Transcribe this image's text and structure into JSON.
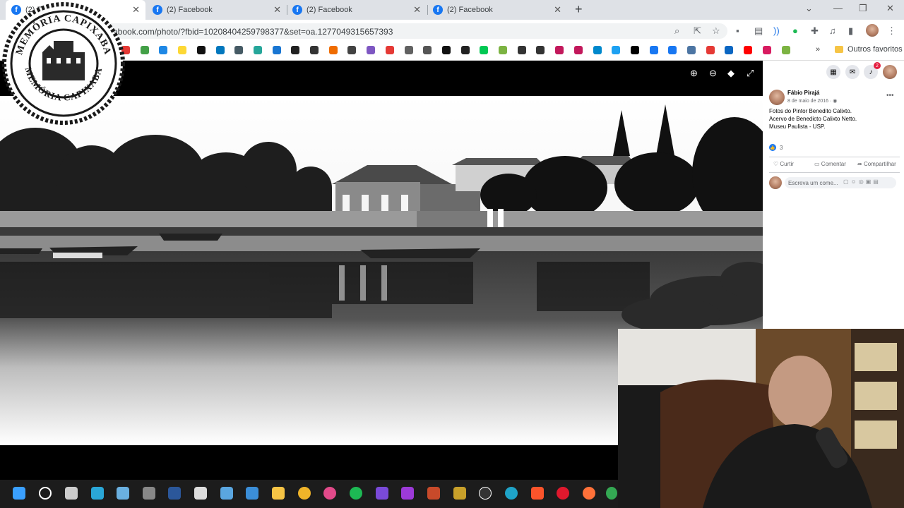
{
  "browser": {
    "tabs": [
      {
        "label": "(2) F",
        "active": true
      },
      {
        "label": "(2) Facebook",
        "active": false
      },
      {
        "label": "(2) Facebook",
        "active": false
      },
      {
        "label": "(2) Facebook",
        "active": false
      }
    ],
    "url": "ebook.com/photo/?fbid=10208404259798377&set=oa.1277049315657393",
    "bookmark_folder": "Outros favoritos",
    "bookmark_overflow": "»"
  },
  "stamp": {
    "text_top": "MEMÓRIA CAPIXABA",
    "text_bottom": "MEMÓRIA CAPIXABA"
  },
  "post": {
    "author": "Fábio Pirajá",
    "date": "8 de maio de 2016",
    "caption_lines": [
      "Fotos do Pintor Benedito Calixto.",
      "Acervo de Benedicto Calixto Netto.",
      "Museu Paulista - USP."
    ],
    "reaction_count": "3",
    "actions": {
      "like": "Curtir",
      "comment": "Comentar",
      "share": "Compartilhar"
    },
    "comment_placeholder": "Escreva um come...",
    "notification_count": "2"
  },
  "colors": {
    "facebook_blue": "#1877f2",
    "tabbar": "#dee1e6",
    "notification": "#e41e3f"
  },
  "icons": [
    "facebook-icon",
    "zoom-in-icon",
    "zoom-out-icon",
    "tag-icon",
    "fullscreen-icon",
    "grid-menu-icon",
    "messenger-icon",
    "bell-icon",
    "like-icon",
    "comment-icon",
    "share-icon"
  ]
}
